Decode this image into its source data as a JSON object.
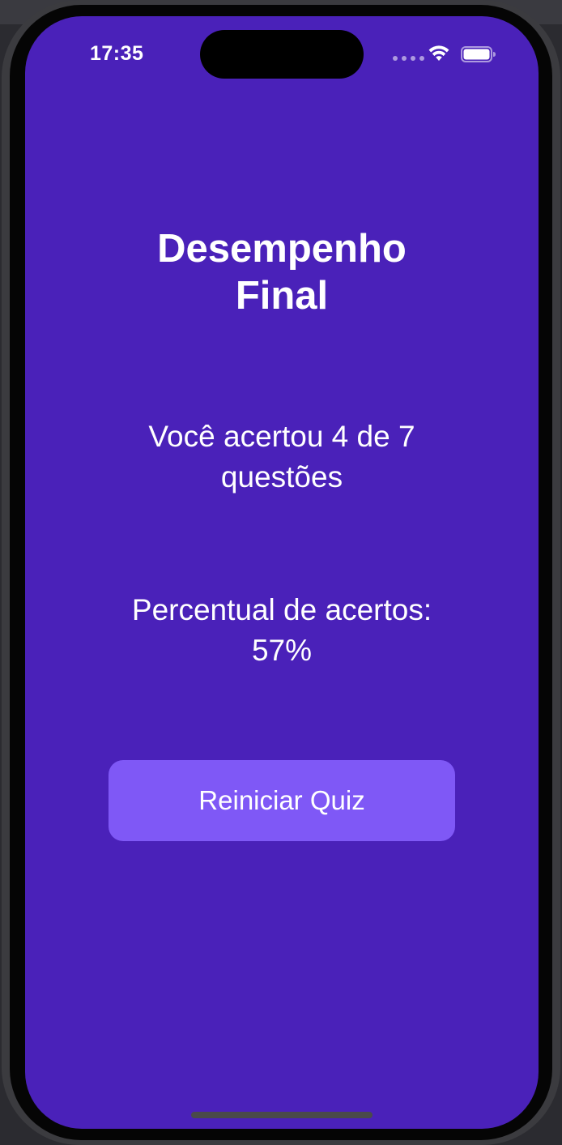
{
  "status_bar": {
    "time": "17:35",
    "icons": [
      "cellular-dots-icon",
      "wifi-icon",
      "battery-icon"
    ]
  },
  "main": {
    "title": "Desempenho Final",
    "score_text": "Você acertou 4 de 7 questões",
    "percent_text": "Percentual de acertos: 57%",
    "restart_button_label": "Reiniciar Quiz"
  },
  "colors": {
    "background": "#4a21b9",
    "button": "#7f58f6",
    "text": "#ffffff"
  }
}
